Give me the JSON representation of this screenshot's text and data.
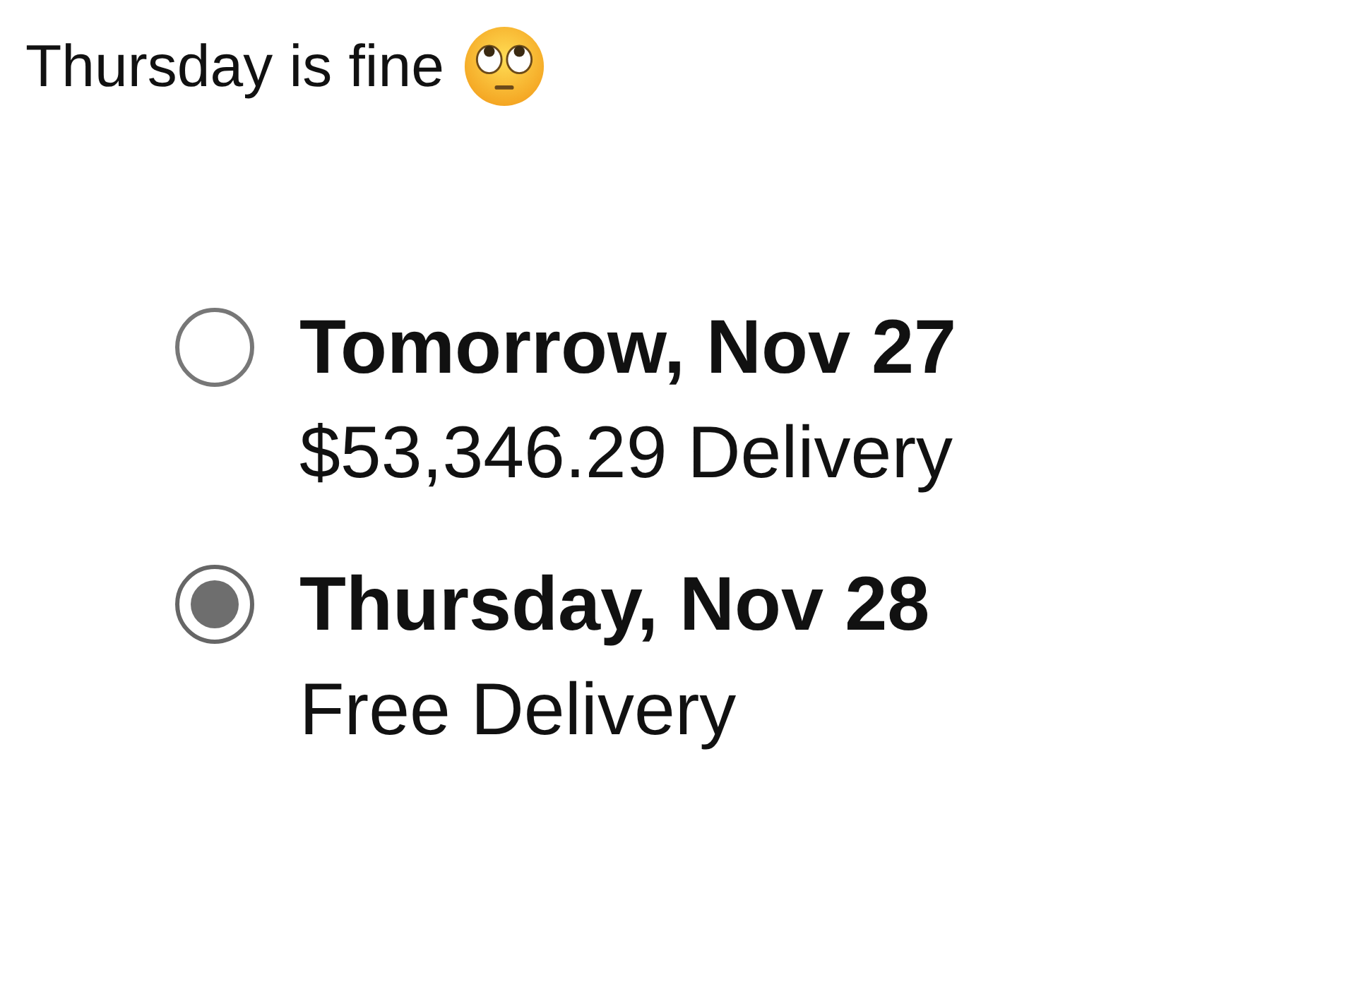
{
  "post": {
    "text": "Thursday is fine"
  },
  "delivery_options": [
    {
      "date": "Tomorrow, Nov 27",
      "price": "$53,346.29 Delivery",
      "selected": false
    },
    {
      "date": "Thursday, Nov 28",
      "price": "Free Delivery",
      "selected": true
    }
  ]
}
